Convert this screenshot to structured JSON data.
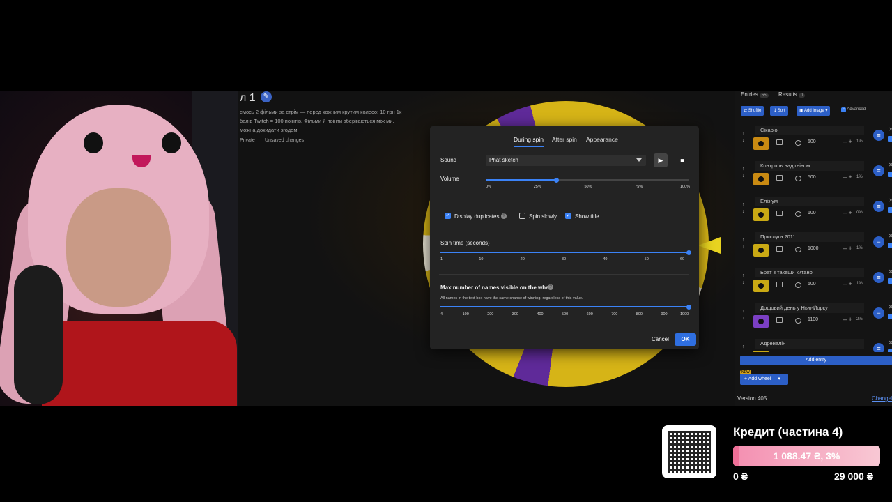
{
  "wheel": {
    "title": "л 1",
    "description": "ємось 2 фільми за стрім — перед кожним крутим колесо: 10 грн 1к балів Twitch = 100 поінтів. Фільми й поінти зберігаються між ми, можна докидати згодом.",
    "visibility": "Private",
    "save_state": "Unsaved changes"
  },
  "dialog": {
    "tabs": [
      "During spin",
      "After spin",
      "Appearance"
    ],
    "active_tab": "During spin",
    "sound_label": "Sound",
    "sound_value": "Phat sketch",
    "volume_label": "Volume",
    "volume_ticks": [
      "0%",
      "25%",
      "50%",
      "75%",
      "100%"
    ],
    "volume_value": 0.35,
    "display_duplicates_label": "Display duplicates",
    "display_duplicates": true,
    "spin_slowly_label": "Spin slowly",
    "spin_slowly": false,
    "show_title_label": "Show title",
    "show_title": true,
    "spin_time_label": "Spin time (seconds)",
    "spin_time_ticks": [
      "1",
      "10",
      "20",
      "30",
      "40",
      "50",
      "60"
    ],
    "spin_time_value": 60,
    "max_names_label": "Max number of names visible on the wheel",
    "max_names_hint": "All names in the text-box have the same chance of winning, regardless of this value.",
    "max_names_ticks": [
      "4",
      "100",
      "200",
      "300",
      "400",
      "500",
      "600",
      "700",
      "800",
      "900",
      "1000"
    ],
    "max_names_value": 1000,
    "cancel_label": "Cancel",
    "ok_label": "OK",
    "play_icon": "▶",
    "stop_icon": "■"
  },
  "sidebar": {
    "entries_tab": "Entries",
    "entries_count": "55",
    "results_tab": "Results",
    "results_count": "0",
    "shuffle_label": "Shuffle",
    "sort_label": "Sort",
    "add_image_label": "Add image",
    "advanced_label": "Advanced",
    "entries": [
      {
        "name": "Сікаріо",
        "weight": "500",
        "percent": "1%",
        "color": "#c98a12"
      },
      {
        "name": "Контроль над гнівом",
        "weight": "500",
        "percent": "1%",
        "color": "#c98a12"
      },
      {
        "name": "Елізіум",
        "weight": "100",
        "percent": "0%",
        "color": "#c9a914"
      },
      {
        "name": "Прислуга 2011",
        "weight": "1000",
        "percent": "1%",
        "color": "#c9a914"
      },
      {
        "name": "Брат з такеши китано",
        "weight": "500",
        "percent": "1%",
        "color": "#c9a914"
      },
      {
        "name": "Дощовий день у Нью-Йорку",
        "weight": "1100",
        "percent": "2%",
        "color": "#7b3fc4"
      },
      {
        "name": "Адреналін",
        "weight": "",
        "percent": "",
        "color": "#c9a914"
      }
    ],
    "add_entry_label": "Add entry",
    "add_wheel_label": "Add wheel",
    "new_badge": "NEW",
    "version": "Version 405",
    "changelog": "Changel"
  },
  "overlay": {
    "goal_title": "Кредит (частина 4)",
    "goal_amount": "1 088.47 ₴, 3%",
    "goal_fraction": 0.0375,
    "goal_min": "0 ₴",
    "goal_max": "29 000 ₴"
  }
}
